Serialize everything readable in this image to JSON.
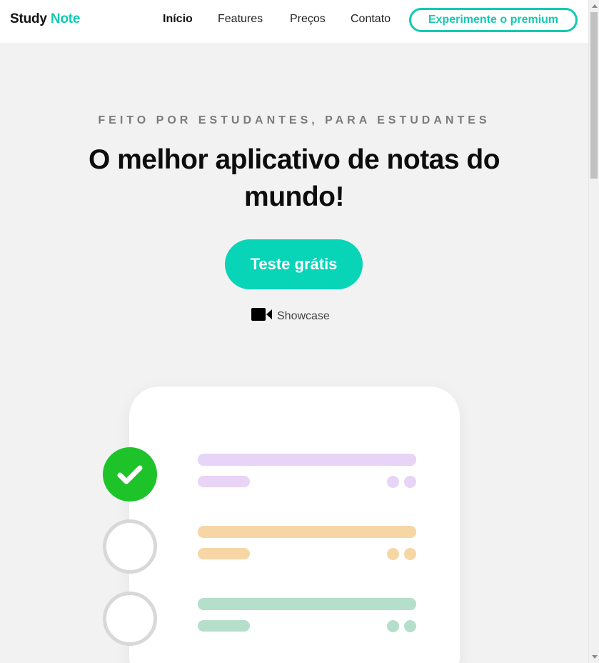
{
  "header": {
    "logo_primary": "Study",
    "logo_accent": "Note",
    "nav": [
      "Início",
      "Features",
      "Preços",
      "Contato"
    ],
    "active_nav": "Início",
    "premium_label": "Experimente o premium"
  },
  "hero": {
    "eyebrow": "FEITO POR ESTUDANTES, PARA ESTUDANTES",
    "title": "O melhor aplicativo de notas do mundo!",
    "cta_label": "Teste grátis",
    "showcase_label": "Showcase",
    "showcase_icon": "video-camera-icon"
  },
  "tasks": [
    {
      "status": "done",
      "color": "#e7d4f6"
    },
    {
      "status": "todo",
      "color": "#f7d6a6"
    },
    {
      "status": "todo",
      "color": "#b5dfca"
    }
  ],
  "colors": {
    "brand": "#13c9b1",
    "cta": "#08d4b8",
    "done": "#1ec329",
    "background": "#f2f2f2"
  }
}
